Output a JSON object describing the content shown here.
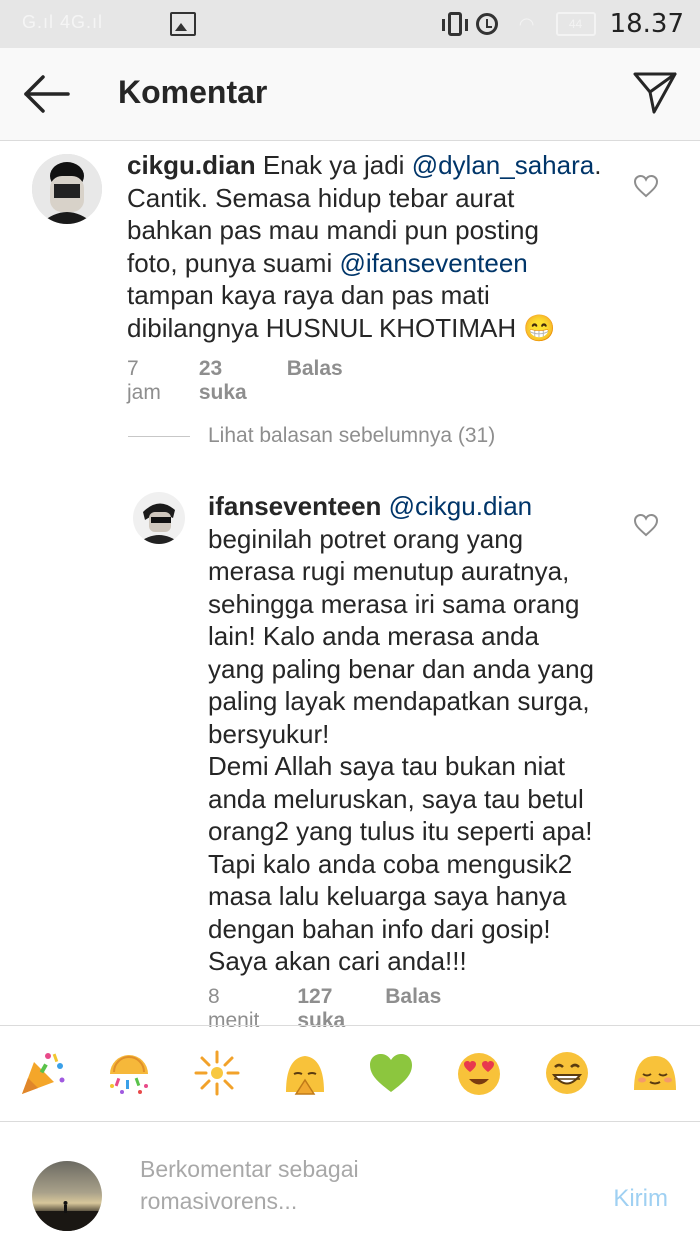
{
  "status_bar": {
    "signal_text": "G.ıl 4G.ıl",
    "time": "18.37",
    "battery": "44",
    "icons": [
      "image-icon",
      "vibrate-icon",
      "alarm-icon",
      "wifi-icon",
      "battery-icon"
    ]
  },
  "header": {
    "title": "Komentar",
    "back_icon": "arrow-left-icon",
    "share_icon": "paper-plane-icon"
  },
  "comments": [
    {
      "username": "cikgu.dian",
      "lines": [
        [
          {
            "t": "Enak ya jadi "
          },
          {
            "m": "@dylan_sahara"
          },
          {
            "t": "."
          }
        ],
        [
          {
            "t": "Cantik. Semasa hidup tebar aurat"
          }
        ],
        [
          {
            "t": "bahkan pas mau mandi pun posting"
          }
        ],
        [
          {
            "t": "foto, punya suami "
          },
          {
            "m": "@ifanseventeen"
          }
        ],
        [
          {
            "t": "tampan kaya raya dan pas mati"
          }
        ],
        [
          {
            "t": "dibilangnya HUSNUL KHOTIMAH 😁"
          }
        ]
      ],
      "time": "7 jam",
      "likes": "23 suka",
      "reply": "Balas"
    },
    {
      "username": "ifanseventeen",
      "lines": [
        [
          {
            "m": "@cikgu.dian"
          }
        ],
        [
          {
            "t": "beginilah potret orang yang"
          }
        ],
        [
          {
            "t": "merasa rugi menutup auratnya,"
          }
        ],
        [
          {
            "t": "sehingga merasa iri sama orang"
          }
        ],
        [
          {
            "t": "lain! Kalo anda merasa anda"
          }
        ],
        [
          {
            "t": "yang paling benar dan anda yang"
          }
        ],
        [
          {
            "t": "paling layak mendapatkan surga,"
          }
        ],
        [
          {
            "t": "bersyukur!"
          }
        ],
        [
          {
            "t": "Demi Allah saya tau bukan niat"
          }
        ],
        [
          {
            "t": "anda meluruskan, saya tau betul"
          }
        ],
        [
          {
            "t": "orang2 yang tulus itu seperti apa!"
          }
        ],
        [
          {
            "t": "Tapi kalo anda coba mengusik2"
          }
        ],
        [
          {
            "t": "masa lalu keluarga saya hanya"
          }
        ],
        [
          {
            "t": "dengan bahan info dari gosip!"
          }
        ],
        [
          {
            "t": "Saya akan cari anda!!!"
          }
        ]
      ],
      "time": "8 menit",
      "likes": "127 suka",
      "reply": "Balas"
    }
  ],
  "view_previous": "Lihat balasan sebelumnya (31)",
  "emoji_bar": [
    "🎉",
    "🎊",
    "🎇",
    "🙏",
    "💚",
    "😍",
    "😁",
    "😊"
  ],
  "composer": {
    "placeholder_line1": "Berkomentar sebagai",
    "placeholder_line2": "romasivorens...",
    "send_label": "Kirim"
  },
  "colors": {
    "mention": "#003569",
    "meta": "#8e8e8e",
    "send_disabled": "#9fd0f2",
    "text": "#262626"
  }
}
